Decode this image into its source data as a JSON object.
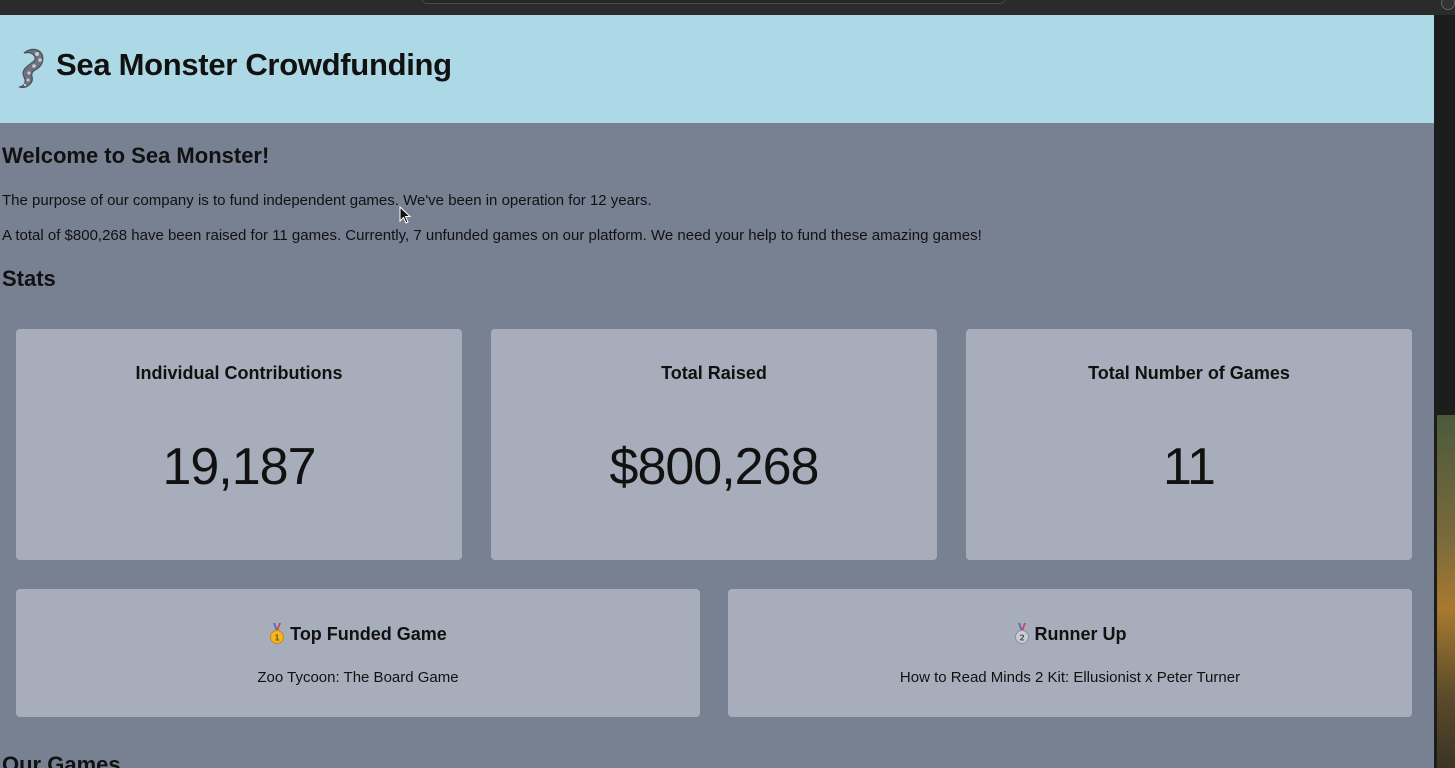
{
  "header": {
    "title": "Sea Monster Crowdfunding",
    "logo_icon": "tentacle-icon",
    "background": "#add8e6"
  },
  "intro": {
    "heading": "Welcome to Sea Monster!",
    "paragraph1": "The purpose of our company is to fund independent games. We've been in operation for 12 years.",
    "paragraph2": "A total of $800,268 have been raised for 11 games. Currently, 7 unfunded games on our platform. We need your help to fund these amazing games!"
  },
  "stats": {
    "heading": "Stats",
    "cards": [
      {
        "label": "Individual Contributions",
        "value": "19,187"
      },
      {
        "label": "Total Raised",
        "value": "$800,268"
      },
      {
        "label": "Total Number of Games",
        "value": "11"
      }
    ]
  },
  "highlights": [
    {
      "icon": "gold-medal-icon",
      "title": "Top Funded Game",
      "game": "Zoo Tycoon: The Board Game"
    },
    {
      "icon": "silver-medal-icon",
      "title": "Runner Up",
      "game": "How to Read Minds 2 Kit: Ellusionist x Peter Turner"
    }
  ],
  "games_heading": "Our Games",
  "colors": {
    "page_background": "#778192",
    "card_background": "#a8adbb",
    "text": "#111111"
  }
}
